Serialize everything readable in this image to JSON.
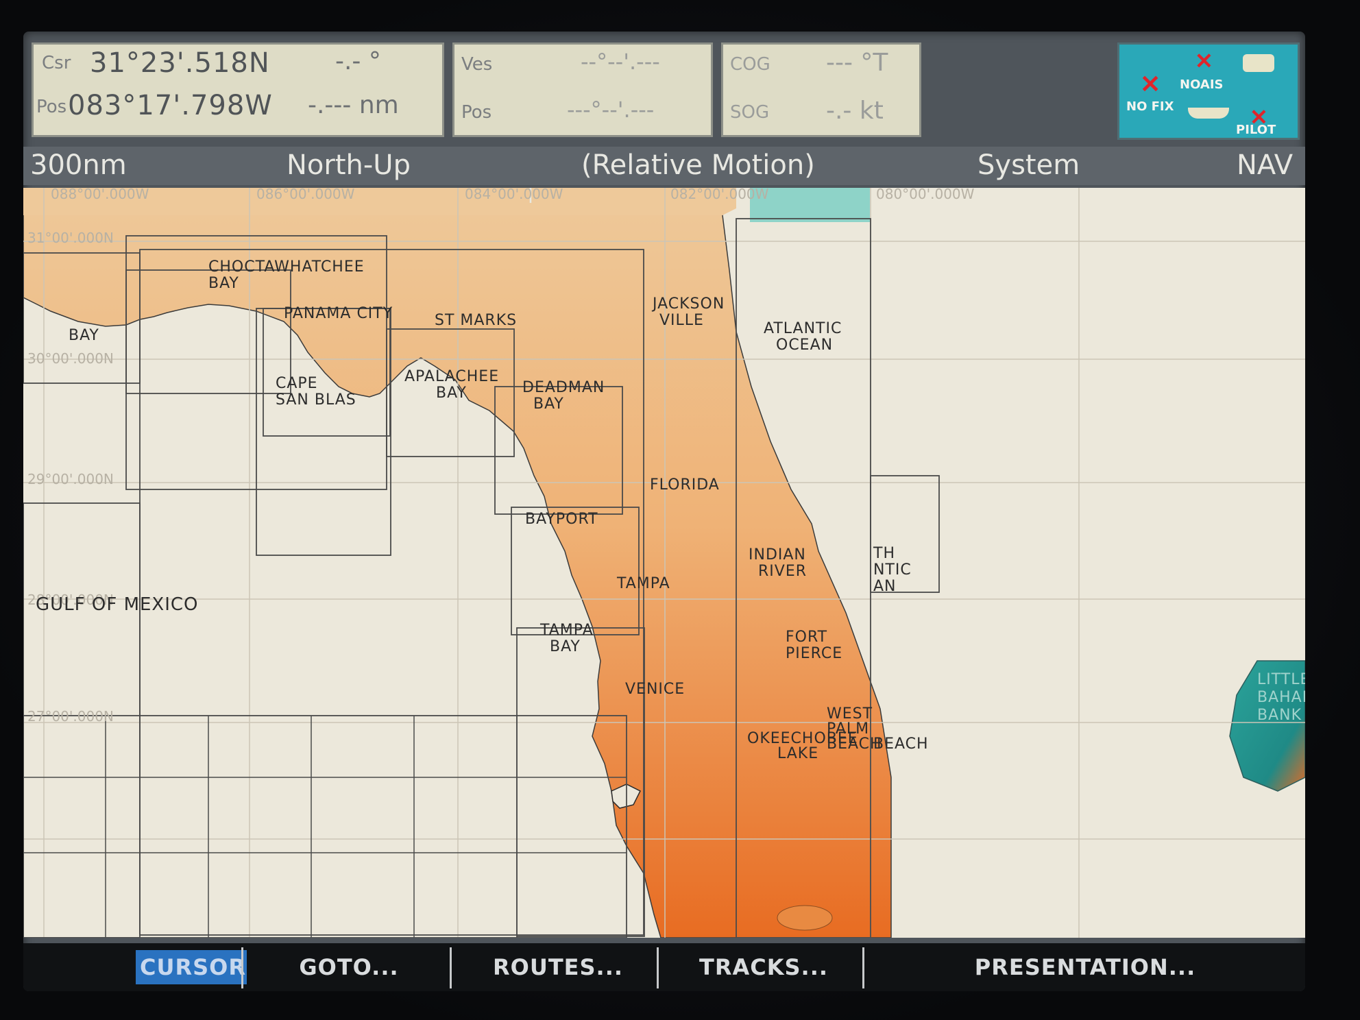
{
  "databoxes": {
    "cursor": {
      "csr_label": "Csr",
      "pos_label": "Pos",
      "lat": "31°23'.518N",
      "lon": "083°17'.798W",
      "bearing": "-.- °",
      "range": "-.--- nm"
    },
    "vessel": {
      "ves_label": "Ves",
      "pos_label": "Pos",
      "lat": "--°--'.---",
      "lon": "---°--'.---"
    },
    "course": {
      "cog_label": "COG",
      "sog_label": "SOG",
      "cog_value": "--- °T",
      "sog_value": "-.- kt"
    }
  },
  "status": {
    "nofix": "NO FIX",
    "noais": "NOAIS",
    "pilot": "PILOT"
  },
  "titlebar": {
    "range": "300nm",
    "orientation": "North-Up",
    "motion": "(Relative Motion)",
    "system": "System",
    "mode": "NAV"
  },
  "grid_labels": {
    "lon1": "088°00'.000W",
    "lon2": "086°00'.000W",
    "lon3": "084°00'.000W",
    "lon4": "082°00'.000W",
    "lon5": "080°00'.000W",
    "lat1": "31°00'.000N",
    "lat2": "30°00'.000N",
    "lat3": "29°00'.000N",
    "lat4": "28°00'.000N",
    "lat5": "27°00'.000N"
  },
  "places": {
    "choctaw1": "CHOCTAWHATCHEE",
    "choctaw2": "BAY",
    "mobile_bay": "BAY",
    "panama_city": "PANAMA CITY",
    "st_marks": "ST MARKS",
    "apalachee1": "APALACHEE",
    "apalachee2": "BAY",
    "cape1": "CAPE",
    "cape2": "SAN BLAS",
    "deadman1": "DEADMAN",
    "deadman2": "BAY",
    "jax1": "JACKSON",
    "jax2": "VILLE",
    "atlantic1": "ATLANTIC",
    "atlantic2": "OCEAN",
    "florida": "FLORIDA",
    "bayport": "BAYPORT",
    "indian1": "INDIAN",
    "indian2": "RIVER",
    "tampa": "TAMPA",
    "tampa_bay1": "TAMPA",
    "tampa_bay2": "BAY",
    "gulf": "GULF OF MEXICO",
    "fort1": "FORT",
    "fort2": "PIERCE",
    "venice": "VENICE",
    "wpb1": "WEST",
    "wpb2": "PALM",
    "wpb3": "BEACH",
    "okee1": "OKEECHOBEE",
    "okee2": "LAKE",
    "beach": "BEACH",
    "north1": "TH",
    "north2": "NTIC",
    "north3": "AN",
    "bahama1": "LITTLE",
    "bahama2": "BAHAMA",
    "bahama3": "BANK"
  },
  "softkeys": {
    "cursor": "CURSOR",
    "goto": "GOTO...",
    "routes": "ROUTES...",
    "tracks": "TRACKS...",
    "presentation": "PRESENTATION..."
  },
  "colors": {
    "land_north": "#ecc592",
    "land_south": "#e8752a",
    "sea": "#ece8db",
    "status_panel": "#2aa8b8",
    "softkey_active": "#2a72c0"
  }
}
